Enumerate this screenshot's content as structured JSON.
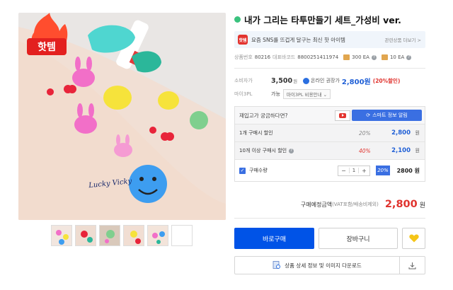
{
  "hero_image": {
    "hot_badge": "핫템",
    "tattoo_text": "Lucky Vicky"
  },
  "thumbnails": [
    "thumb-1",
    "thumb-2",
    "thumb-3",
    "thumb-4",
    "thumb-5",
    "thumb-empty"
  ],
  "product": {
    "title": "내가 그리는 타투만들기 세트_가성비 ver.",
    "title_dot_color": "#3ac27e"
  },
  "promo": {
    "badge": "핫템",
    "text": "요즘 SNS를 뜨겁게 달구는 최신 핫 아이템",
    "link": "관련상품 더보기 >"
  },
  "codes": {
    "product_no_label": "상품번호",
    "product_no": "80216",
    "barcode_label": "대표바코드",
    "barcode": "8800251411974",
    "box_qty": "300 EA",
    "pack_qty": "10 EA"
  },
  "pricing": {
    "consumer_label": "소비자가",
    "consumer_price": "3,500",
    "won": "원",
    "online_label": "온라인 권장가",
    "online_price": "2,800원",
    "discount": "(20%할인)"
  },
  "shipping": {
    "label": "마이3PL",
    "value": "가능",
    "select": "마이3PL 비용안내"
  },
  "box": {
    "question": "재입고가 궁금하다면?",
    "smart_button": "스마트 정보 알림",
    "discount_rows": [
      {
        "label": "1개 구매시 할인",
        "pct": "20%",
        "price": "2,800",
        "won": "원"
      },
      {
        "label": "10개 이상 구매시 할인",
        "pct": "40%",
        "price": "2,100",
        "won": "원"
      }
    ],
    "qty_label": "구매수량",
    "qty_minus": "−",
    "qty_value": "1",
    "qty_plus": "+",
    "qty_pct": "20%",
    "qty_price": "2800 원"
  },
  "total": {
    "label": "구매예정금액",
    "sub": "(VAT포함/배송비제외)",
    "price": "2,800",
    "won": "원"
  },
  "actions": {
    "buy": "바로구매",
    "cart": "장바구니"
  },
  "download": {
    "label": "상품 상세 정보 및 이미지 다운로드"
  },
  "colors": {
    "primary": "#0053e7",
    "accent_blue": "#3a6fe2",
    "price_red": "#e0342f",
    "heart_yellow": "#f5c518"
  }
}
